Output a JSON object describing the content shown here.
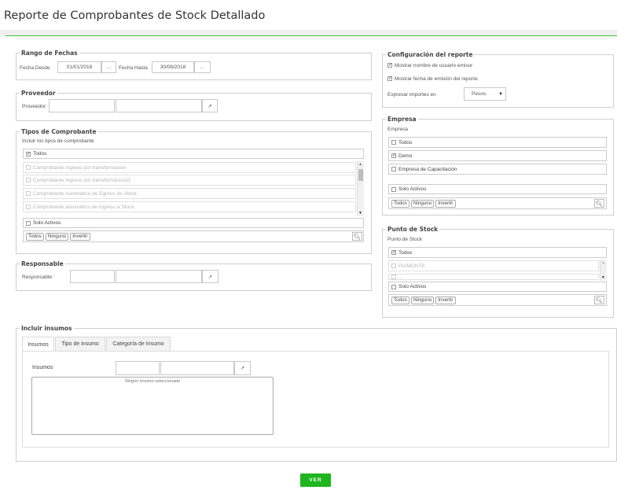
{
  "page_title": "Reporte de Comprobantes de Stock Detallado",
  "rango": {
    "legend": "Rango de Fechas",
    "desde_label": "Fecha Desde",
    "desde_value": "01/01/2018",
    "hasta_label": "Fecha Hasta",
    "hasta_value": "30/08/2018",
    "picker": "..."
  },
  "proveedor": {
    "legend": "Proveedor",
    "label": "Proveedor:"
  },
  "tipos": {
    "legend": "Tipos de Comprobante",
    "subtitle": "Incluir los tipos de comprobante",
    "todos": "Todos",
    "items": [
      "Comprobante ingreso por transformación",
      "Comprobante ingreso por transformacionO",
      "Comprobante Automático de Egreso de Stock",
      "Comprobante automático de ingreso a Stock"
    ],
    "solo_activos": "Solo Activos"
  },
  "selector_buttons": {
    "todos": "Todos",
    "ninguno": "Ninguno",
    "invertir": "Invertir"
  },
  "responsable": {
    "legend": "Responsable",
    "label": "Responsable:"
  },
  "config": {
    "legend": "Configuración del reporte",
    "mostrar_usuario": "Mostrar nombre de usuario emisor",
    "mostrar_fecha": "Mostrar fecha de emisión del reporte",
    "importes_label": "Expresar importes en",
    "importes_value": "Pesos"
  },
  "empresa": {
    "legend": "Empresa",
    "subtitle": "Empresa",
    "todos": "Todos",
    "items": [
      "Demo",
      "Empresa de Capacitación"
    ],
    "solo_activos": "Solo Activos"
  },
  "punto": {
    "legend": "Punto de Stock",
    "subtitle": "Punto de Stock",
    "todos": "Todos",
    "items": [
      "PIAMONTE",
      "..."
    ],
    "solo_activos": "Solo Activos"
  },
  "insumos": {
    "legend": "Incluir insumos",
    "tabs": [
      "Insumos",
      "Tipo de insumo",
      "Categoría de Insumo"
    ],
    "label": "Insumos",
    "empty_text": "Ningún insumo seleccionado"
  },
  "ver_button": "VER",
  "icons": {
    "external": "external-link-icon",
    "search": "search-icon"
  }
}
